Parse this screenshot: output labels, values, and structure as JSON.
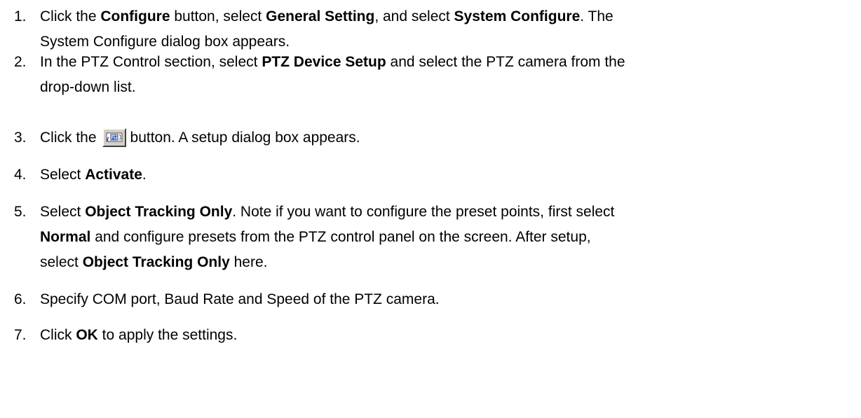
{
  "steps": [
    {
      "number": "1.",
      "lines": [
        [
          {
            "t": "Click the ",
            "b": false
          },
          {
            "t": "Configure",
            "b": true
          },
          {
            "t": " button, select ",
            "b": false
          },
          {
            "t": "General Setting",
            "b": true
          },
          {
            "t": ", and select ",
            "b": false
          },
          {
            "t": "System Configure",
            "b": true
          },
          {
            "t": ". The",
            "b": false
          }
        ],
        [
          {
            "t": "System Configure dialog box appears.",
            "b": false
          }
        ]
      ]
    },
    {
      "number": "2.",
      "lines": [
        [
          {
            "t": "In the PTZ Control section, select ",
            "b": false
          },
          {
            "t": "PTZ Device Setup",
            "b": true
          },
          {
            "t": " and select the PTZ camera from the",
            "b": false
          }
        ],
        [
          {
            "t": "drop-down list.",
            "b": false
          }
        ]
      ]
    },
    {
      "number": "3.",
      "lines": [
        [
          {
            "t": "Click the",
            "b": false
          },
          {
            "icon": "ptz-setup-button-icon"
          },
          {
            "t": "button. A setup dialog box appears.",
            "b": false
          }
        ]
      ]
    },
    {
      "number": "4.",
      "lines": [
        [
          {
            "t": "Select ",
            "b": false
          },
          {
            "t": "Activate",
            "b": true
          },
          {
            "t": ".",
            "b": false
          }
        ]
      ]
    },
    {
      "number": "5.",
      "lines": [
        [
          {
            "t": "Select ",
            "b": false
          },
          {
            "t": "Object Tracking Only",
            "b": true
          },
          {
            "t": ". Note if you want to configure the preset points, first select",
            "b": false
          }
        ],
        [
          {
            "t": "Normal",
            "b": true
          },
          {
            "t": " and configure presets from the PTZ control panel on the screen. After setup,",
            "b": false
          }
        ],
        [
          {
            "t": "select ",
            "b": false
          },
          {
            "t": "Object Tracking Only",
            "b": true
          },
          {
            "t": " here.",
            "b": false
          }
        ]
      ]
    },
    {
      "number": "6.",
      "lines": [
        [
          {
            "t": "Specify COM port, Baud Rate and Speed of the PTZ camera.",
            "b": false
          }
        ]
      ]
    },
    {
      "number": "7.",
      "lines": [
        [
          {
            "t": "Click ",
            "b": false
          },
          {
            "t": "OK",
            "b": true
          },
          {
            "t": " to apply the settings.",
            "b": false
          }
        ]
      ]
    }
  ]
}
